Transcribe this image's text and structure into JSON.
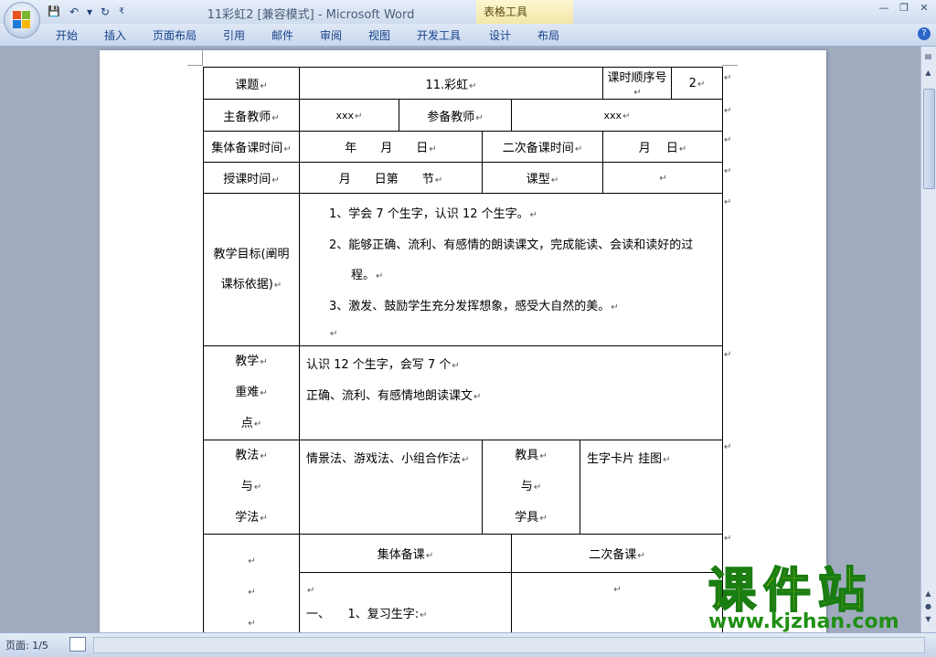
{
  "window": {
    "title": "11彩虹2 [兼容模式] - Microsoft Word",
    "context_group": "表格工具",
    "minimize": "—",
    "restore": "❐",
    "close": "✕"
  },
  "qat": {
    "save": "💾",
    "undo": "↶",
    "dropdown": "▾",
    "redo": "↻",
    "customize": "₹"
  },
  "ribbon": {
    "tabs": [
      "开始",
      "插入",
      "页面布局",
      "引用",
      "邮件",
      "审阅",
      "视图",
      "开发工具",
      "设计",
      "布局"
    ],
    "help": "?"
  },
  "status": {
    "page": "页面: 1/5"
  },
  "watermark": {
    "text": "课件站",
    "url": "www.kjzhan.com"
  },
  "mark": "↵",
  "table": {
    "r1": {
      "l1": "课题",
      "v1": "11.彩虹",
      "l2": "课时顺序号",
      "v2": "2"
    },
    "r2": {
      "l1": "主备教师",
      "v1": "xxx",
      "l2": "参备教师",
      "v2": "xxx"
    },
    "r3": {
      "l1": "集体备课时间",
      "v1": "年　　月　　日",
      "l2": "二次备课时间",
      "v2": "月　 日"
    },
    "r4": {
      "l1": "授课时间",
      "v1": "月　　日第　　节",
      "l2": "课型",
      "v2": ""
    },
    "r5": {
      "label": [
        "教学目标(阐明",
        "课标依据)"
      ],
      "items": [
        "1、学会 7 个生字，认识 12 个生字。",
        "2、能够正确、流利、有感情的朗读课文，完成能读、会读和读好的过",
        "程。",
        "3、激发、鼓励学生充分发挥想象，感受大自然的美。"
      ]
    },
    "r6": {
      "label": [
        "教学",
        "重难",
        "点"
      ],
      "lines": [
        "认识 12 个生字，会写 7 个",
        "正确、流利、有感情地朗读课文"
      ]
    },
    "r7": {
      "label": [
        "教法",
        "与",
        "学法"
      ],
      "v1": "情景法、游戏法、小组合作法",
      "label2": [
        "教具",
        "与",
        "学具"
      ],
      "v2": "生字卡片 挂图"
    },
    "r8": {
      "h1": "集体备课",
      "h2": "二次备课"
    },
    "r9": {
      "line": "一、　　1、复习生字:"
    }
  }
}
